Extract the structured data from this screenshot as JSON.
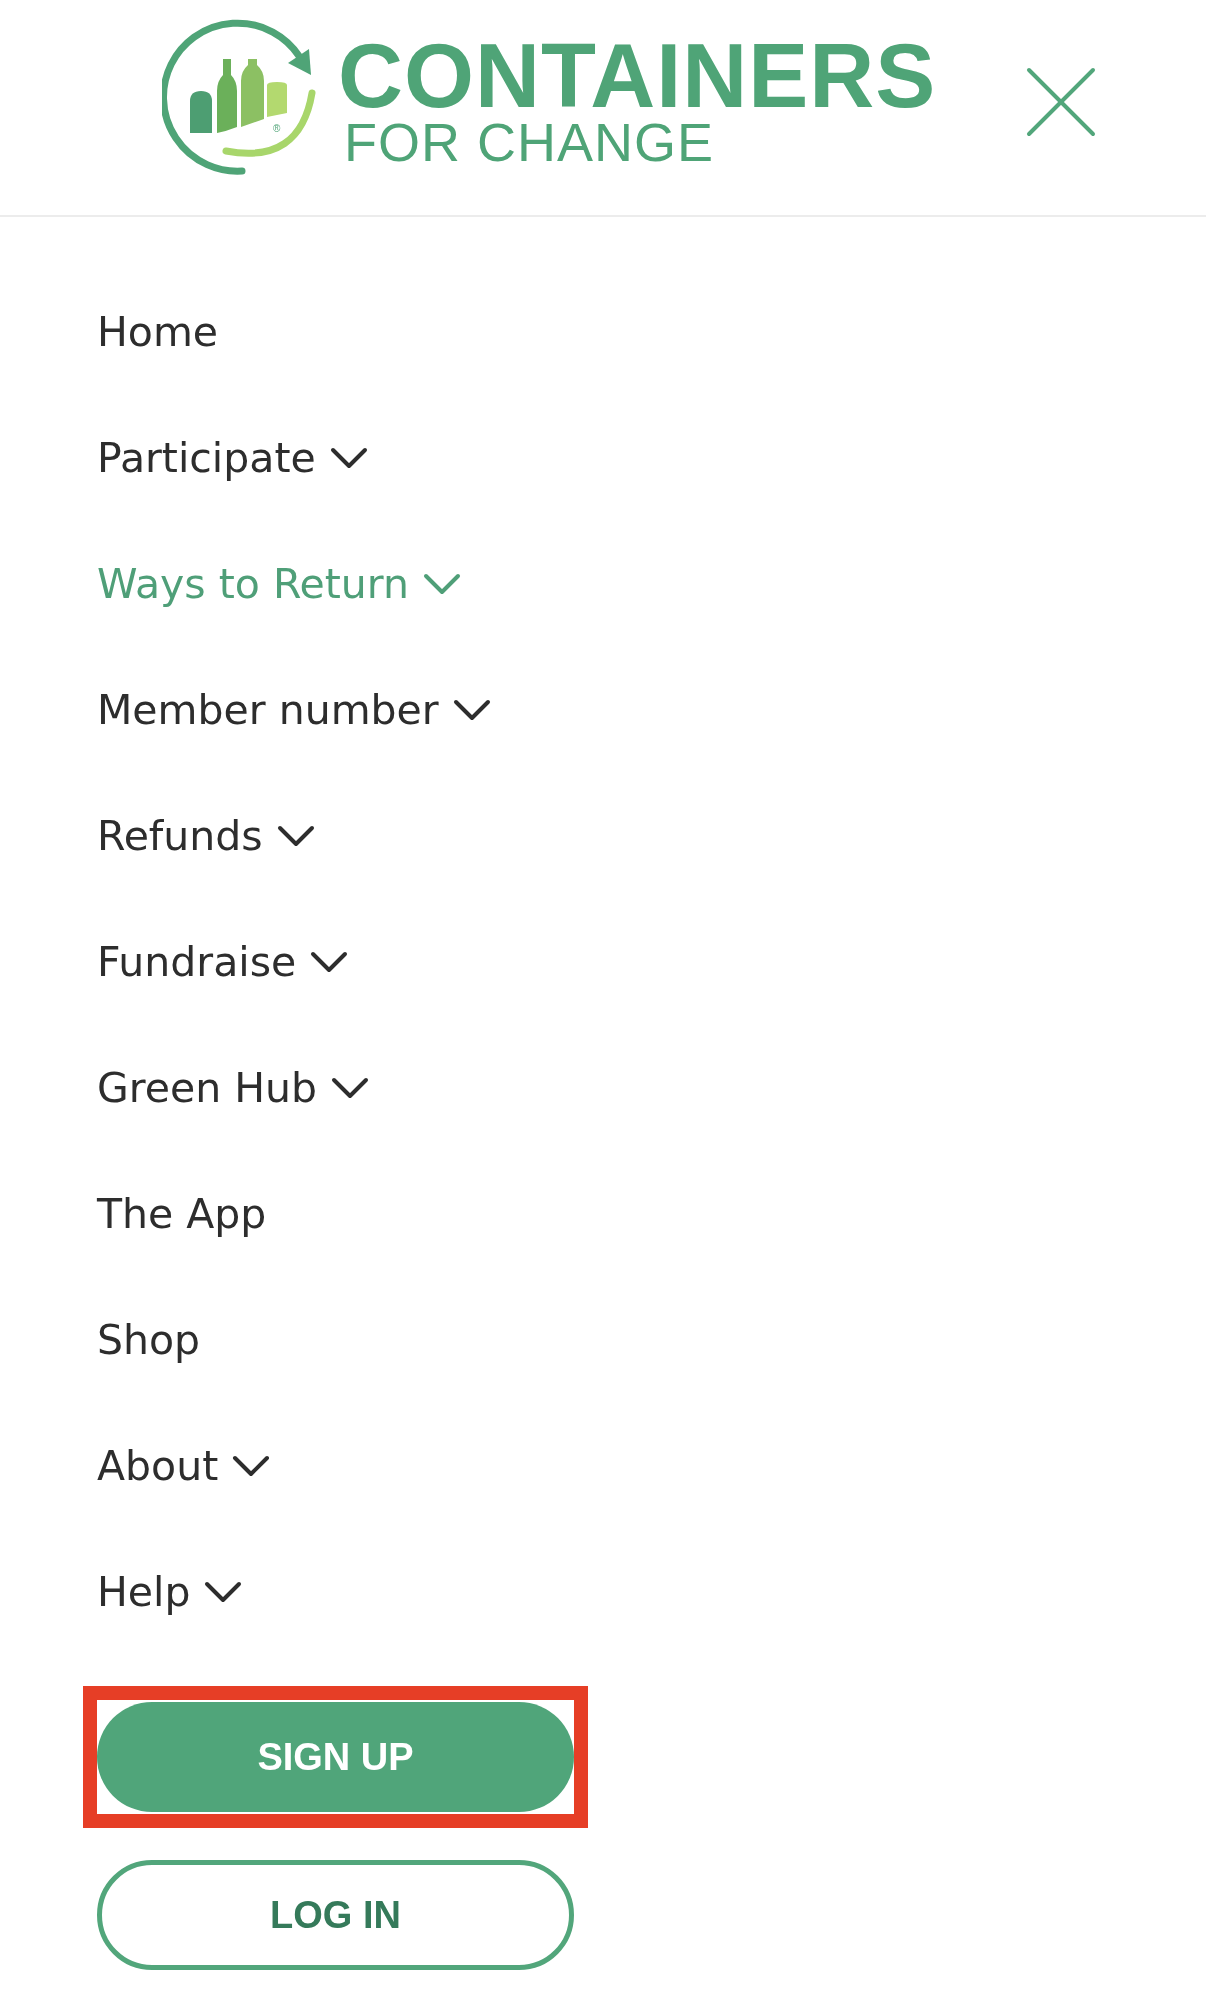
{
  "header": {
    "logo": {
      "title": "CONTAINERS",
      "subtitle": "FOR CHANGE",
      "registered_mark": "®"
    }
  },
  "menu": {
    "items": [
      {
        "label": "Home",
        "expandable": false,
        "selected": false
      },
      {
        "label": "Participate",
        "expandable": true,
        "selected": false
      },
      {
        "label": "Ways to Return",
        "expandable": true,
        "selected": true
      },
      {
        "label": "Member number",
        "expandable": true,
        "selected": false
      },
      {
        "label": "Refunds",
        "expandable": true,
        "selected": false
      },
      {
        "label": "Fundraise",
        "expandable": true,
        "selected": false
      },
      {
        "label": "Green Hub",
        "expandable": true,
        "selected": false
      },
      {
        "label": "The App",
        "expandable": false,
        "selected": false
      },
      {
        "label": "Shop",
        "expandable": false,
        "selected": false
      },
      {
        "label": "About",
        "expandable": true,
        "selected": false
      },
      {
        "label": "Help",
        "expandable": true,
        "selected": false
      }
    ]
  },
  "actions": {
    "sign_up": {
      "label": "SIGN UP",
      "highlighted": true
    },
    "log_in": {
      "label": "LOG IN"
    }
  }
}
